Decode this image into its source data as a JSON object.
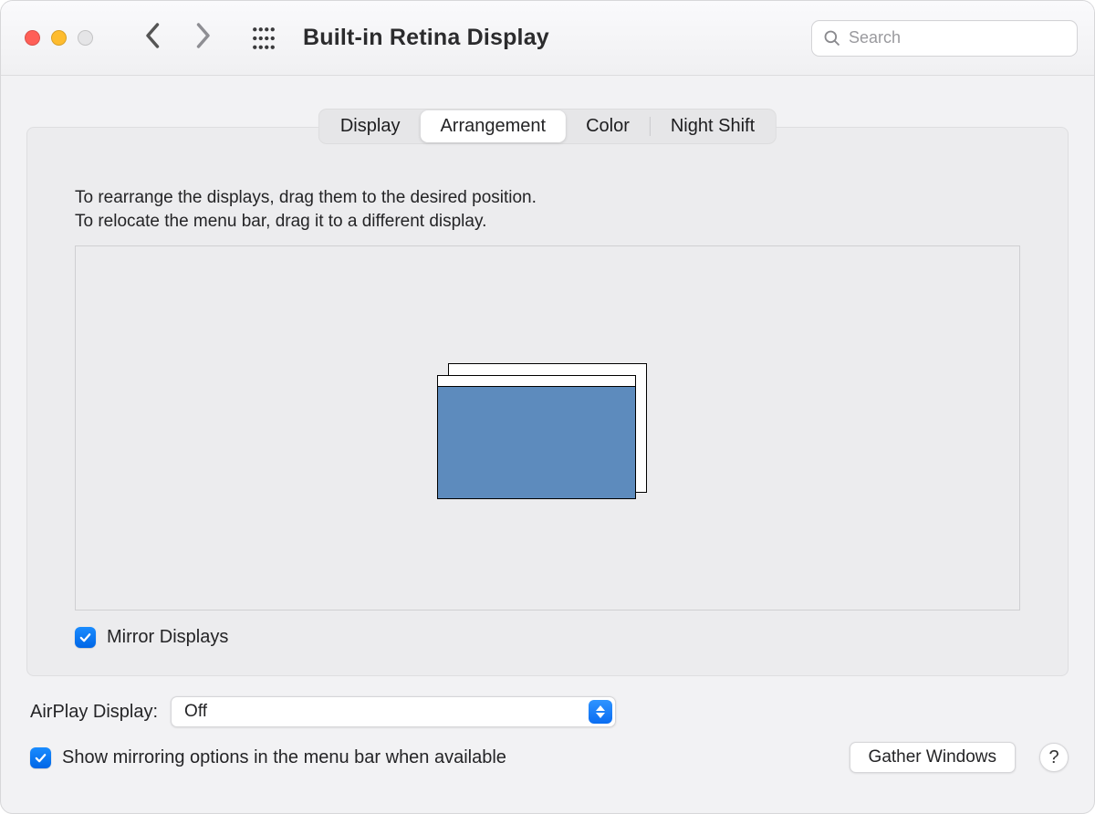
{
  "window": {
    "title": "Built-in Retina Display"
  },
  "search": {
    "placeholder": "Search"
  },
  "tabs": [
    {
      "label": "Display"
    },
    {
      "label": "Arrangement"
    },
    {
      "label": "Color"
    },
    {
      "label": "Night Shift"
    }
  ],
  "active_tab_index": 1,
  "instructions": {
    "line1": "To rearrange the displays, drag them to the desired position.",
    "line2": "To relocate the menu bar, drag it to a different display."
  },
  "mirror": {
    "label": "Mirror Displays",
    "checked": true
  },
  "airplay": {
    "label": "AirPlay Display:",
    "selected": "Off"
  },
  "show_mirroring": {
    "label": "Show mirroring options in the menu bar when available",
    "checked": true
  },
  "gather_button": "Gather Windows",
  "help_glyph": "?",
  "colors": {
    "accent": "#0a6df2",
    "display_fill": "#5d8bbd"
  }
}
